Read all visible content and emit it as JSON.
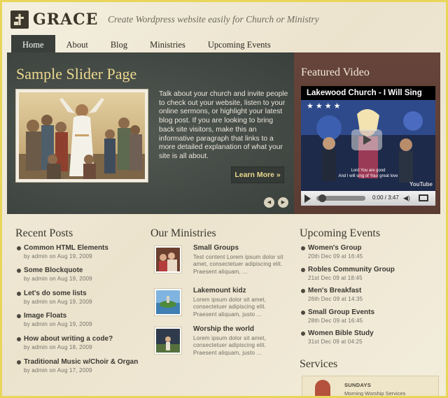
{
  "site": {
    "logo_text": "GRACE",
    "tagline": "Create Wordpress website easily for Church or Ministry"
  },
  "nav": {
    "items": [
      {
        "label": "Home",
        "active": true
      },
      {
        "label": "About",
        "active": false
      },
      {
        "label": "Blog",
        "active": false
      },
      {
        "label": "Ministries",
        "active": false
      },
      {
        "label": "Upcoming Events",
        "active": false
      }
    ]
  },
  "slider": {
    "title": "Sample Slider Page",
    "text": "Talk about your church and invite people to check out your website, listen to your online sermons, or highlight your latest blog post. If you are looking to bring back site visitors, make this an informative paragraph that links to a more detailed explanation of what your site is all about.",
    "more_label": "Learn More »",
    "prev_icon": "◀",
    "next_icon": "▶"
  },
  "featured_video": {
    "title": "Featured Video",
    "video_name": "Lakewood Church - I Will Sing",
    "stars": "★★★★",
    "caption_line1": "Lord You are good",
    "caption_line2": "And I will sing of Your great love",
    "brand": "YouTube",
    "time": "0:00 / 3:47",
    "volume_icon": "◀)"
  },
  "recent_posts": {
    "title": "Recent Posts",
    "items": [
      {
        "title": "Common HTML Elements",
        "meta": "by admin on Aug 19, 2009"
      },
      {
        "title": "Some Blockquote",
        "meta": "by admin on Aug 19, 2009"
      },
      {
        "title": "Let's do some lists",
        "meta": "by admin on Aug 19, 2009"
      },
      {
        "title": "Image Floats",
        "meta": "by admin on Aug 19, 2009"
      },
      {
        "title": "How about writing a code?",
        "meta": "by admin on Aug 18, 2009"
      },
      {
        "title": "Traditional Music w/Choir & Organ",
        "meta": "by admin on Aug 17, 2009"
      }
    ]
  },
  "ministries": {
    "title": "Our Ministries",
    "items": [
      {
        "title": "Small Groups",
        "text": "Test content Lorem ipsum dolor sit amet, consectetuer adipiscing elit. Praesent aliquam, ..."
      },
      {
        "title": "Lakemount kidz",
        "text": "Lorem ipsum dolor sit amet, consectetuer adipiscing elit. Praesent aliquam, justo ..."
      },
      {
        "title": "Worship the world",
        "text": "Lorem ipsum dolor sit amet, consectetuer adipiscing elit. Praesent aliquam, justo ..."
      }
    ]
  },
  "events": {
    "title": "Upcoming Events",
    "items": [
      {
        "title": "Women's Group",
        "date": "20th Dec 09 at 16:45"
      },
      {
        "title": "Robles Community Group",
        "date": "21st Dec 09 at 18:45"
      },
      {
        "title": "Men's Breakfast",
        "date": "26th Dec 09 at 14:35"
      },
      {
        "title": "Small Group Events",
        "date": "28th Dec 09 at 16:45"
      },
      {
        "title": "Women Bible Study",
        "date": "31st Dec 09 at 04:25"
      }
    ]
  },
  "services": {
    "title": "Services",
    "day": "SUNDAYS",
    "item": "Morning Worship Services"
  }
}
